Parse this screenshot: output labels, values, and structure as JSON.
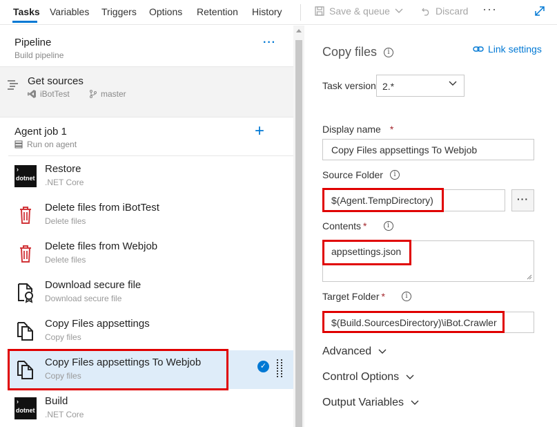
{
  "tabs": [
    "Tasks",
    "Variables",
    "Triggers",
    "Options",
    "Retention",
    "History"
  ],
  "toolbar": {
    "save_label": "Save & queue",
    "discard_label": "Discard"
  },
  "pipeline": {
    "title": "Pipeline",
    "subtitle": "Build pipeline"
  },
  "sources": {
    "title": "Get sources",
    "repo": "iBotTest",
    "branch": "master"
  },
  "agent_job": {
    "title": "Agent job 1",
    "subtitle": "Run on agent"
  },
  "tasks": [
    {
      "title": "Restore",
      "subtitle": ".NET Core",
      "icon": "dotnet"
    },
    {
      "title": "Delete files from iBotTest",
      "subtitle": "Delete files",
      "icon": "trash"
    },
    {
      "title": "Delete files from Webjob",
      "subtitle": "Delete files",
      "icon": "trash"
    },
    {
      "title": "Download secure file",
      "subtitle": "Download secure file",
      "icon": "secure-file"
    },
    {
      "title": "Copy Files appsettings",
      "subtitle": "Copy files",
      "icon": "copy"
    },
    {
      "title": "Copy Files appsettings To Webjob",
      "subtitle": "Copy files",
      "icon": "copy"
    },
    {
      "title": "Build",
      "subtitle": ".NET Core",
      "icon": "dotnet"
    }
  ],
  "dotnet_label": "dotnet",
  "details": {
    "title": "Copy files",
    "link_settings": "Link settings",
    "task_version_label": "Task version",
    "task_version": "2.*",
    "display_name_label": "Display name",
    "display_name": "Copy Files appsettings To Webjob",
    "source_folder_label": "Source Folder",
    "source_folder": "$(Agent.TempDirectory)",
    "contents_label": "Contents",
    "contents": "appsettings.json",
    "target_folder_label": "Target Folder",
    "target_folder": "$(Build.SourcesDirectory)\\iBot.Crawler",
    "required_mark": "*",
    "sections": [
      "Advanced",
      "Control Options",
      "Output Variables"
    ]
  },
  "colors": {
    "accent": "#0078d4",
    "highlight": "#e00000",
    "selected_bg": "#deecf9",
    "trash": "#d13438"
  }
}
